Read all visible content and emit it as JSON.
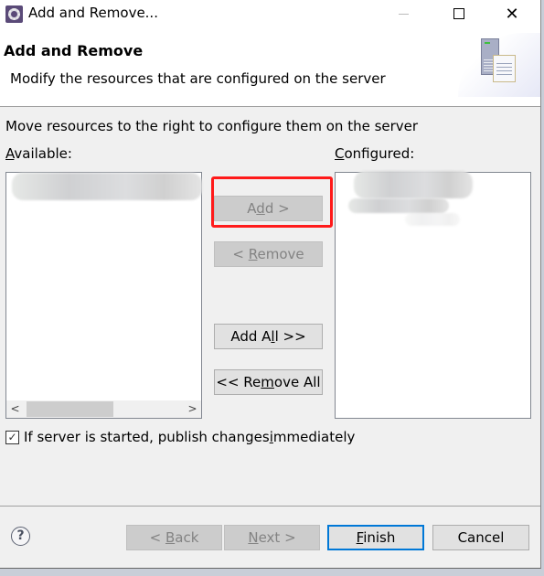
{
  "window": {
    "title": "Add and Remove...",
    "icon": "eclipse-gear-icon",
    "controls": {
      "minimize": "minimize-icon",
      "maximize": "maximize-icon",
      "close": "✕"
    }
  },
  "header": {
    "title": "Add and Remove",
    "description": "Modify the resources that are configured on the server",
    "graphic": "server-config-icon"
  },
  "instruction": "Move resources to the right to configure them on the server",
  "available": {
    "label_mnemonic": "A",
    "label_rest": "vailable:",
    "items": [
      "(blurred resource)"
    ],
    "scroll_left": "<",
    "scroll_right": ">"
  },
  "configured": {
    "label_mnemonic": "C",
    "label_rest": "onfigured:",
    "items": [
      "(blurred resource)"
    ]
  },
  "buttons": {
    "add": {
      "pre": "A",
      "mn": "d",
      "post": "d >",
      "enabled": false
    },
    "remove": {
      "pre": "< ",
      "mn": "R",
      "post": "emove",
      "enabled": false
    },
    "add_all": {
      "pre": "Add A",
      "mn": "l",
      "post": "l >>",
      "enabled": true
    },
    "remove_all": {
      "pre": "<< Re",
      "mn": "m",
      "post": "ove All",
      "enabled": true
    }
  },
  "publish_checkbox": {
    "checked": true,
    "check_glyph": "✓",
    "pre": "If server is started, publish changes ",
    "mn": "i",
    "post": "mmediately"
  },
  "footer": {
    "help": "?",
    "back": {
      "pre": "< ",
      "mn": "B",
      "post": "ack",
      "enabled": false
    },
    "next": {
      "pre": "",
      "mn": "N",
      "post": "ext >",
      "enabled": false
    },
    "finish": {
      "pre": "",
      "mn": "F",
      "post": "inish",
      "enabled": true
    },
    "cancel": {
      "label": "Cancel",
      "enabled": true
    }
  },
  "annotation": {
    "highlight_color": "#ff1a1a",
    "target": "add-button"
  },
  "colors": {
    "default_button_border": "#0078d7",
    "dialog_bg": "#f0f0f0"
  }
}
